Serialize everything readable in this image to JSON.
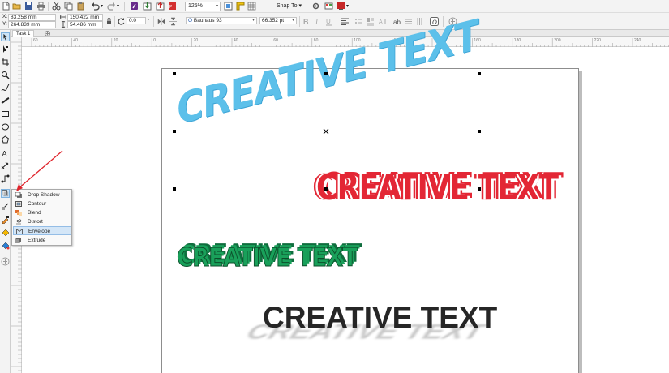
{
  "toolbar": {
    "zoom_value": "125%",
    "snap_label": "Snap To"
  },
  "property_bar": {
    "x_label": "X:",
    "x_value": "83.258 mm",
    "y_label": "Y:",
    "y_value": "264.839 mm",
    "width_value": "150.422 mm",
    "height_value": "54.486 mm",
    "rotation_value": "0.0",
    "font_name": "Bauhaus 93",
    "font_size": "66.352 pt"
  },
  "tabs": [
    {
      "label": "Task 1"
    }
  ],
  "ruler": {
    "h_ticks": [
      "60",
      "40",
      "20",
      "0",
      "20",
      "40",
      "60",
      "80",
      "100",
      "120",
      "140",
      "160",
      "180",
      "200",
      "220",
      "240"
    ]
  },
  "flyout": {
    "items": [
      {
        "label": "Drop Shadow",
        "icon": "drop-shadow-icon"
      },
      {
        "label": "Contour",
        "icon": "contour-icon"
      },
      {
        "label": "Blend",
        "icon": "blend-icon"
      },
      {
        "label": "Distort",
        "icon": "distort-icon"
      },
      {
        "label": "Envelope",
        "icon": "envelope-icon"
      },
      {
        "label": "Extrude",
        "icon": "extrude-icon"
      }
    ],
    "highlighted": "Envelope"
  },
  "artwork": {
    "text1": "CREATIVE TEXT",
    "text2": "CREATIVE TEXT",
    "text3": "CREATIVE TEXT",
    "text4": "CREATIVE TEXT"
  },
  "colors": {
    "text1": "#5cc0ea",
    "text2": "#e32735",
    "text3": "#19a05a",
    "text4": "#262626",
    "annotation_arrow": "#e0242c"
  }
}
